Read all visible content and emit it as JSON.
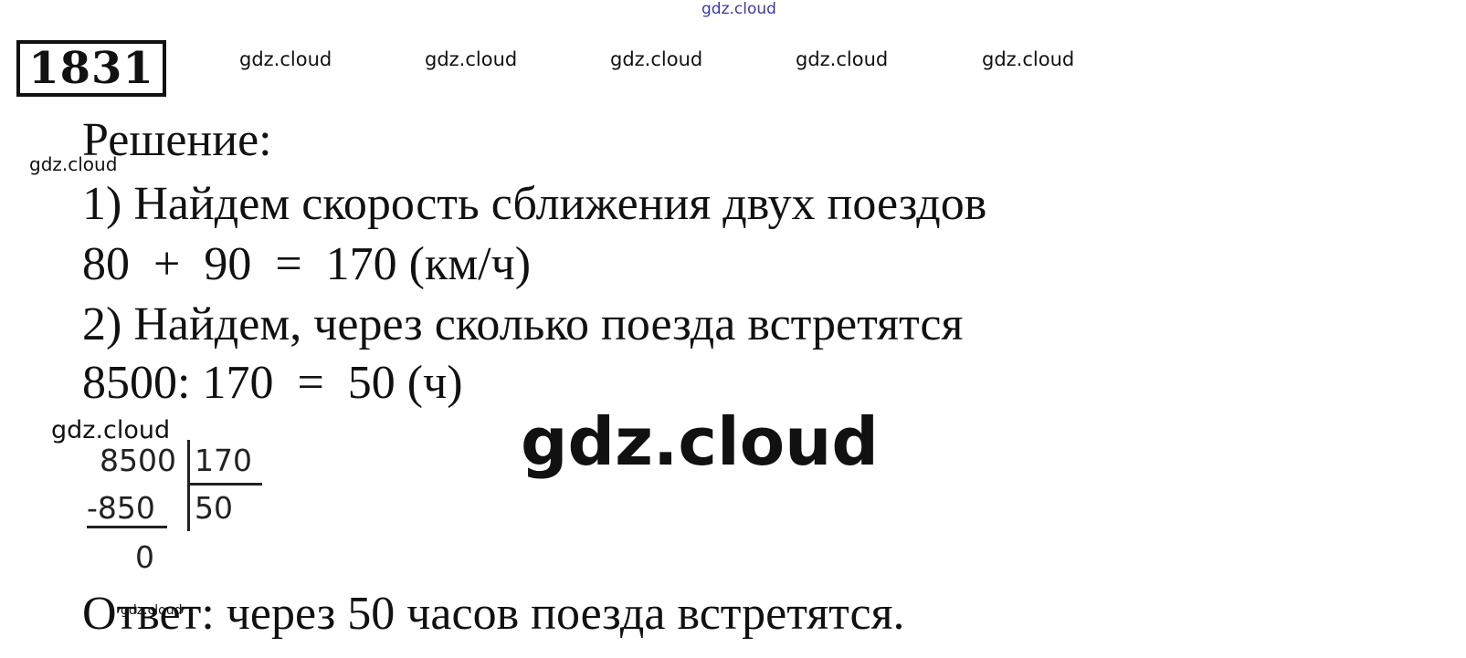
{
  "problem_number": "1831",
  "watermarks": {
    "top": "gdz.cloud",
    "row": [
      "gdz.cloud",
      "gdz.cloud",
      "gdz.cloud",
      "gdz.cloud",
      "gdz.cloud"
    ],
    "left1": "gdz.cloud",
    "left2": "gdz.cloud",
    "big": "gdz.cloud",
    "small": "gdz.cloud"
  },
  "solution": {
    "heading": "Решение:",
    "step1": "1) Найдем скорость сближения двух поездов",
    "calc1": "80  +  90  =  170 (км/ч)",
    "step2": "2) Найдем, через сколько поезда встретятся",
    "calc2": "8500: 170  =  50 (ч)",
    "answer": "Ответ: через 50 часов поезда встретятся."
  },
  "long_division": {
    "dividend": "8500",
    "divisor": "170",
    "subtrahend": "-850",
    "quotient": "50",
    "remainder": "0"
  }
}
